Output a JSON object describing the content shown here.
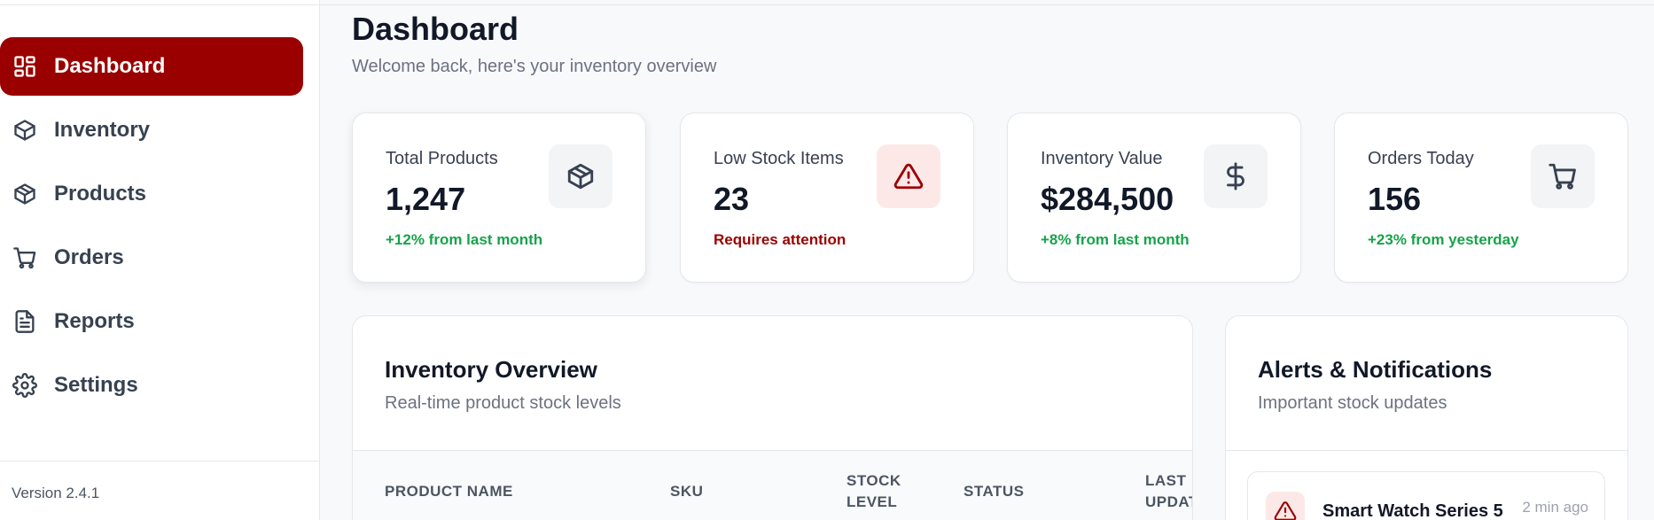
{
  "sidebar": {
    "items": [
      {
        "label": "Dashboard",
        "icon": "dashboard-grid-icon",
        "active": true
      },
      {
        "label": "Inventory",
        "icon": "box-icon"
      },
      {
        "label": "Products",
        "icon": "package-icon"
      },
      {
        "label": "Orders",
        "icon": "cart-icon"
      },
      {
        "label": "Reports",
        "icon": "file-text-icon"
      },
      {
        "label": "Settings",
        "icon": "gear-icon"
      }
    ],
    "version": "Version 2.4.1"
  },
  "header": {
    "title": "Dashboard",
    "subtitle": "Welcome back, here's your inventory overview"
  },
  "stats": [
    {
      "label": "Total Products",
      "value": "1,247",
      "note": "+12% from last month",
      "note_color": "#16a34a",
      "icon": "box-icon"
    },
    {
      "label": "Low Stock Items",
      "value": "23",
      "note": "Requires attention",
      "note_color": "#9b0000",
      "icon": "alert-triangle-icon"
    },
    {
      "label": "Inventory Value",
      "value": "$284,500",
      "note": "+8% from last month",
      "note_color": "#16a34a",
      "icon": "dollar-icon"
    },
    {
      "label": "Orders Today",
      "value": "156",
      "note": "+23% from yesterday",
      "note_color": "#16a34a",
      "icon": "cart-icon"
    }
  ],
  "inventory_panel": {
    "title": "Inventory Overview",
    "subtitle": "Real-time product stock levels",
    "columns": [
      "PRODUCT NAME",
      "SKU",
      "STOCK\nLEVEL",
      "STATUS",
      "LAST\nUPDATED"
    ]
  },
  "alerts_panel": {
    "title": "Alerts & Notifications",
    "subtitle": "Important stock updates",
    "items": [
      {
        "title": "Smart Watch Series 5",
        "time": "2 min ago",
        "icon": "alert-triangle-icon"
      }
    ]
  },
  "colors": {
    "accent": "#9b0000",
    "positive": "#16a34a"
  }
}
